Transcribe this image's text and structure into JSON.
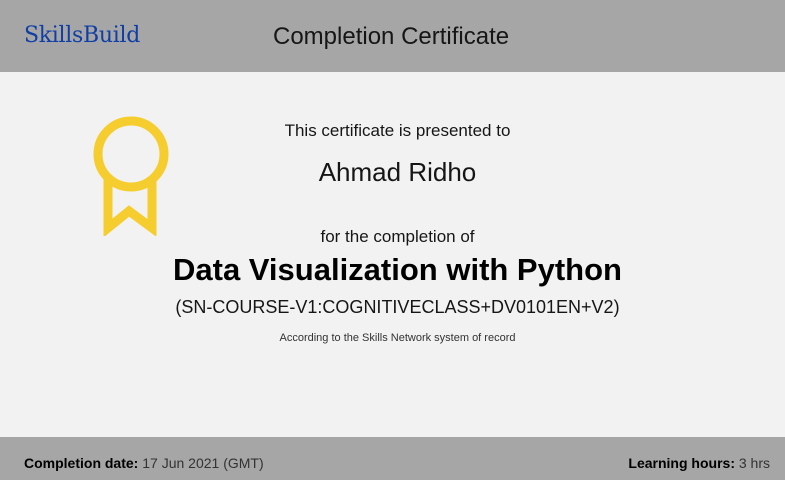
{
  "header": {
    "brand": "SkillsBuild",
    "title": "Completion Certificate"
  },
  "badge": {
    "icon": "ribbon-badge-icon",
    "color": "#f6cd2e"
  },
  "certificate": {
    "presented_text": "This certificate is presented to",
    "recipient": "Ahmad Ridho",
    "completion_text": "for the completion of",
    "course_title": "Data Visualization with Python",
    "course_code": "(SN-COURSE-V1:COGNITIVECLASS+DV0101EN+V2)",
    "record_note": "According to the Skills Network system of record"
  },
  "footer": {
    "completion_date_label": "Completion date:",
    "completion_date_value": "17 Jun 2021 (GMT)",
    "learning_hours_label": "Learning hours:",
    "learning_hours_value": "3 hrs"
  },
  "colors": {
    "bar": "#a6a6a6",
    "background": "#f2f2f2",
    "brand": "#0f3fa6"
  }
}
